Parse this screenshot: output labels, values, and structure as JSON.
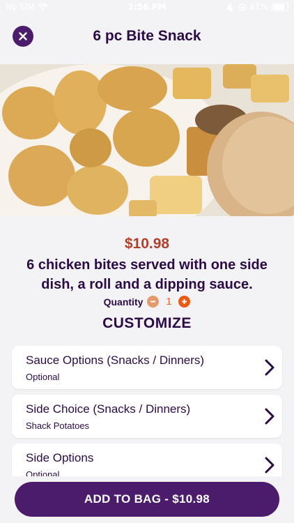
{
  "status_bar": {
    "carrier": "No SIM",
    "time": "2:56 PM",
    "battery": "81%"
  },
  "header": {
    "title": "6 pc Bite Snack",
    "close_icon": "close-icon"
  },
  "item": {
    "price": "$10.98",
    "description": "6 chicken bites served with one side dish, a roll and a dipping sauce.",
    "quantity_label": "Quantity",
    "quantity_value": "1"
  },
  "customize": {
    "heading": "CUSTOMIZE",
    "options": [
      {
        "title": "Sauce Options (Snacks / Dinners)",
        "subtitle": "Optional"
      },
      {
        "title": "Side Choice (Snacks / Dinners)",
        "subtitle": "Shack Potatoes"
      },
      {
        "title": "Side Options",
        "subtitle": "Optional"
      }
    ]
  },
  "footer": {
    "add_to_bag": "ADD TO BAG - $10.98"
  },
  "colors": {
    "brand_purple": "#4b1c6b",
    "title_text": "#2b0b44",
    "price": "#b1402b",
    "accent_orange": "#ea5a15"
  }
}
